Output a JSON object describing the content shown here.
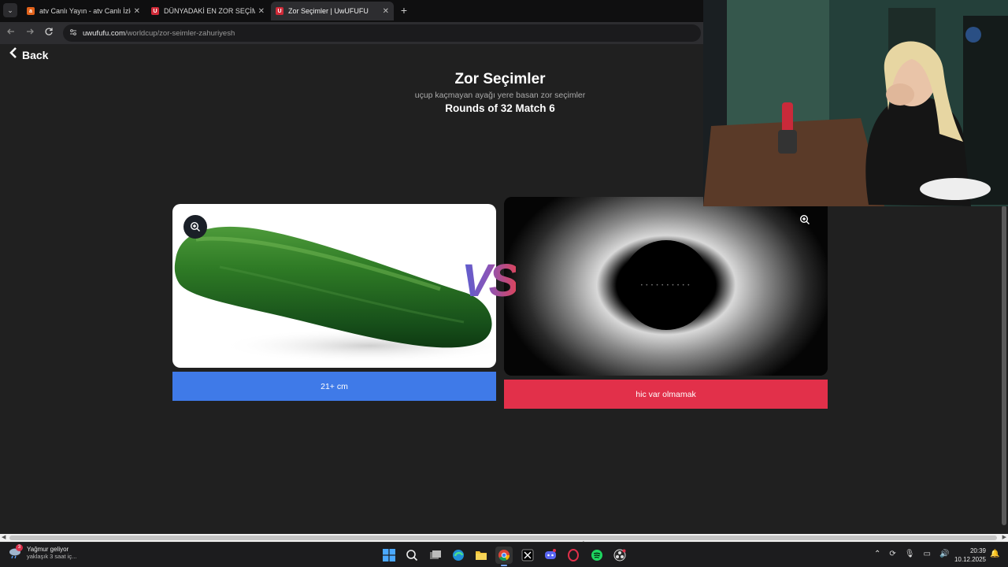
{
  "browser": {
    "tabs": [
      {
        "title": "atv Canlı Yayın - atv Canlı İzle -",
        "favicon_color": "#e2621a",
        "active": false
      },
      {
        "title": "DÜNYADAKİ EN ZOR SEÇİMLER",
        "favicon_color": "#d02a38",
        "active": false
      },
      {
        "title": "Zor Seçimler | UwUFUFU",
        "favicon_color": "#d02a38",
        "active": true
      }
    ],
    "favicon_letter": "U",
    "favicon_letter_atv": "a",
    "new_tab": "+",
    "close_glyph": "✕",
    "url_host": "uwufufu.com",
    "url_path": "/worldcup/zor-seimler-zahuriyesh"
  },
  "page": {
    "back_label": "Back",
    "title": "Zor Seçimler",
    "subtitle": "uçup kaçmayan ayağı yere basan zor seçimler",
    "round_info": "Rounds of 32 Match 6",
    "vs_label": "VS",
    "left_choice": {
      "label": "21+ cm",
      "color": "#3f7ae8",
      "image": "cucumber"
    },
    "right_choice": {
      "label": "hic var olmamak",
      "color": "#e2304a",
      "image": "black-hole"
    }
  },
  "taskbar": {
    "weather_title": "Yağmur geliyor",
    "weather_sub": "yaklaşık 3 saat iç...",
    "weather_badge": "3",
    "time": "20:39",
    "date": "10.12.2025"
  }
}
